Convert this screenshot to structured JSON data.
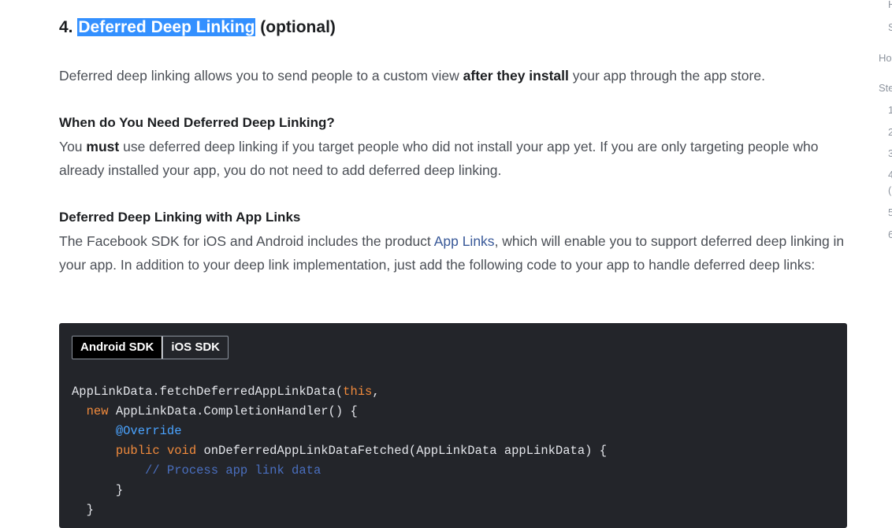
{
  "article": {
    "heading_prefix": "4. ",
    "heading_highlight": "Deferred Deep Linking",
    "heading_suffix": " (optional)",
    "intro_1": "Deferred deep linking allows you to send people to a custom view ",
    "intro_bold": "after they install",
    "intro_2": " your app through the app store.",
    "section1_title": "When do You Need Deferred Deep Linking?",
    "section1_a": "You ",
    "section1_bold": "must",
    "section1_b": " use deferred deep linking if you target people who did not install your app yet. If you are only targeting people who already installed your app, you do not need to add deferred deep linking.",
    "section2_title": "Deferred Deep Linking with App Links",
    "section2_a": "The Facebook SDK for iOS and Android includes the product ",
    "section2_link": "App Links",
    "section2_b": ", which will enable you to support deferred deep linking in your app. In addition to your deep link implementation, just add the following code to your app to handle deferred deep links:"
  },
  "code": {
    "tabs": [
      "Android SDK",
      "iOS SDK"
    ],
    "active_tab": "Android SDK",
    "l1a": "AppLinkData.fetchDeferredAppLinkData(",
    "l1kw": "this",
    "l1b": ",",
    "l2kw": "new",
    "l2b": " AppLinkData.CompletionHandler() {",
    "l3an": "@Override",
    "l4kw1": "public",
    "l4kw2": "void",
    "l4b": " onDeferredAppLinkDataFetched(AppLinkData appLinkData) {",
    "l5cm": "// Process app link data",
    "l6": "}",
    "l7": "}"
  },
  "sidebar": {
    "items": [
      "H",
      "S",
      "Ho",
      "Ste",
      "1",
      "2",
      "3",
      "4",
      "(",
      "5",
      "6"
    ]
  }
}
